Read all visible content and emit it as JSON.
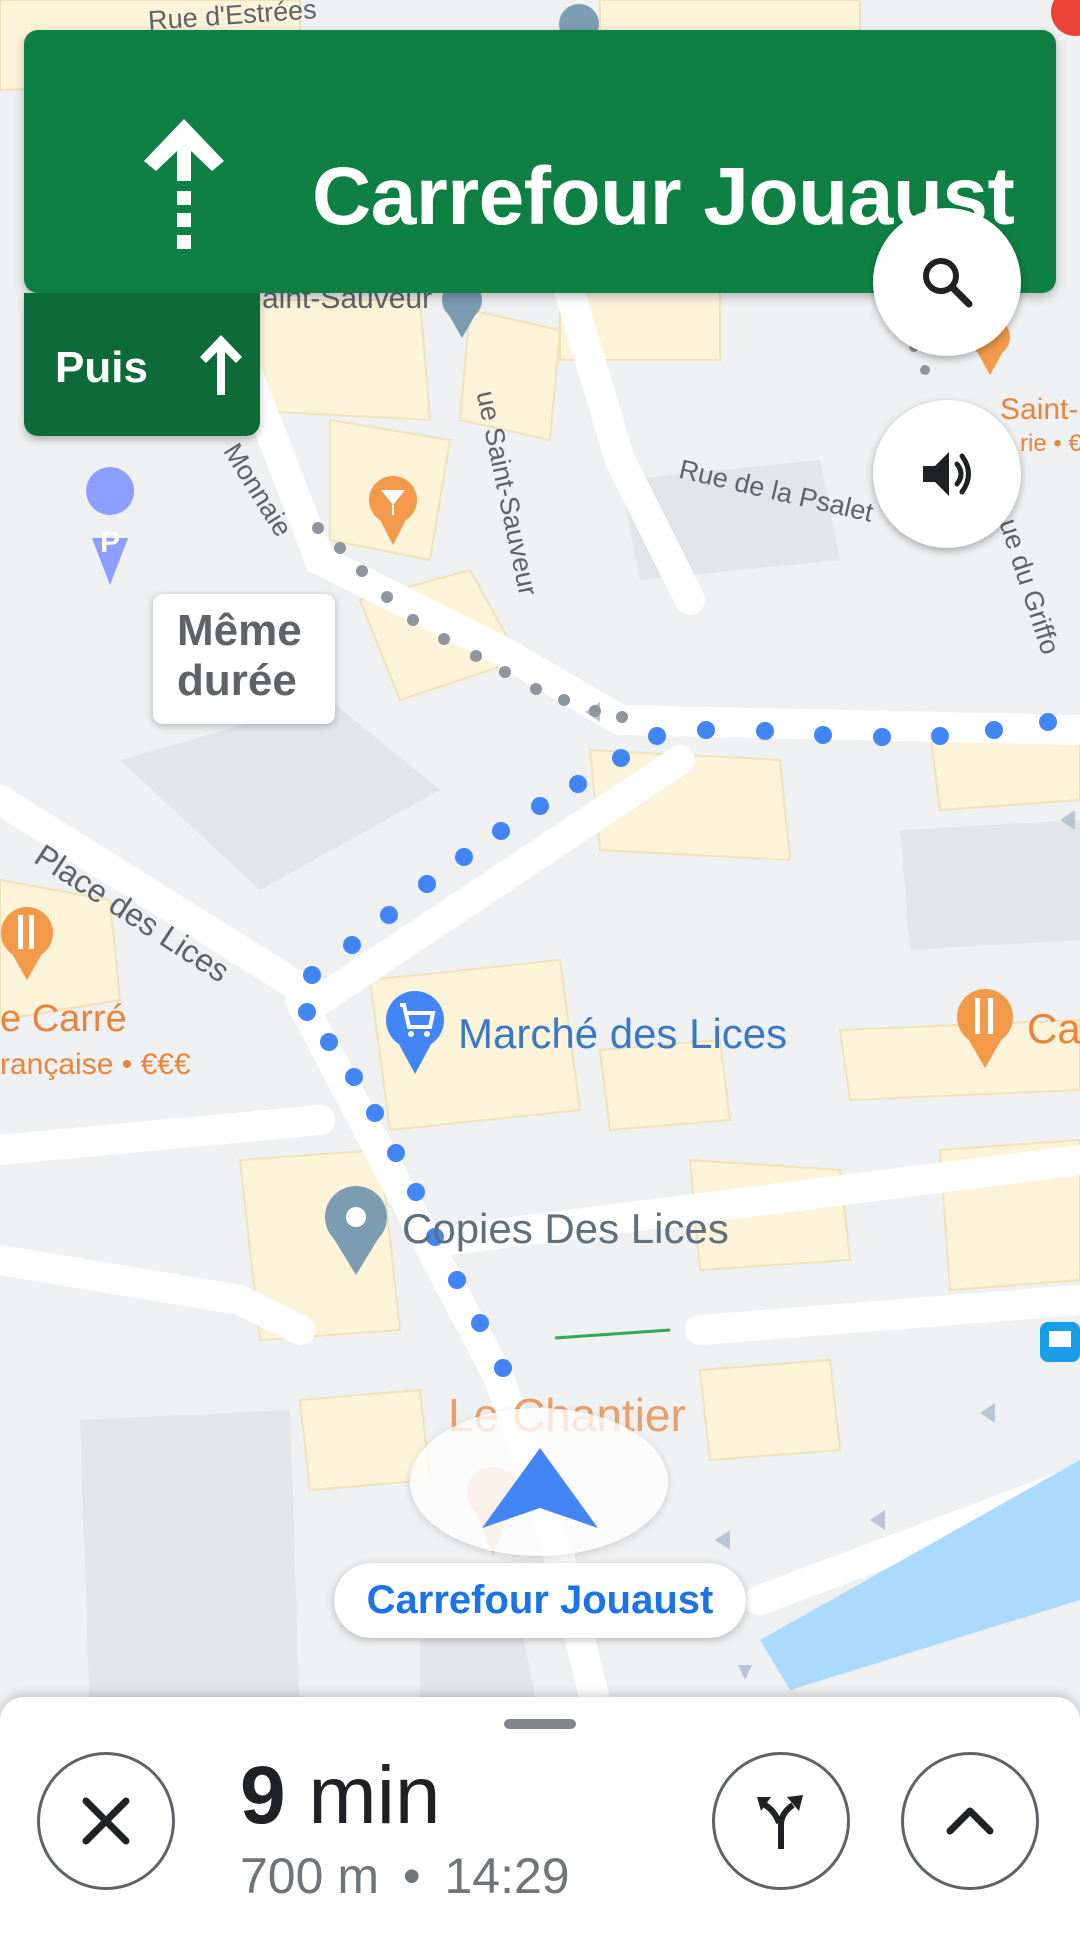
{
  "navigation": {
    "next_street": "Carrefour Jouaust",
    "maneuver_icon": "arrow-straight-icon",
    "then_label": "Puis",
    "then_icon": "arrow-up-icon"
  },
  "map": {
    "alternate_route_label_line1": "Même",
    "alternate_route_label_line2": "durée",
    "destination_chip": "Carrefour Jouaust",
    "streets": {
      "rue_estrees": "Rue d'Estrées",
      "saint_sauveur_top": "aint-Sauveur",
      "rue_saint_sauveur": "ue Saint-Sauveur",
      "monnaie": "Monnaie",
      "rue_psalette": "Rue de la Psalet",
      "rue_griffon": "ue du Griffo",
      "place_des_lices": "Place des Lices"
    },
    "places": {
      "marche": "Marché des Lices",
      "copies": "Copies Des Lices",
      "le_chantier": "Le Chantier",
      "le_carre": "e Carré",
      "le_carre_sub": "rançaise • €€€",
      "saint_partial": "Saint-",
      "saint_partial_sub": "rie • €",
      "ca_partial": "Ca"
    },
    "colors": {
      "route_blue": "#4285f4",
      "alt_route_gray": "#9aa0a6",
      "banner_green": "#0f8043",
      "then_green": "#0c6b37"
    }
  },
  "controls": {
    "search_icon": "search-icon",
    "sound_icon": "volume-icon"
  },
  "trip": {
    "duration_number": "9",
    "duration_unit": "min",
    "distance": "700 m",
    "separator": "•",
    "arrival": "14:29"
  }
}
